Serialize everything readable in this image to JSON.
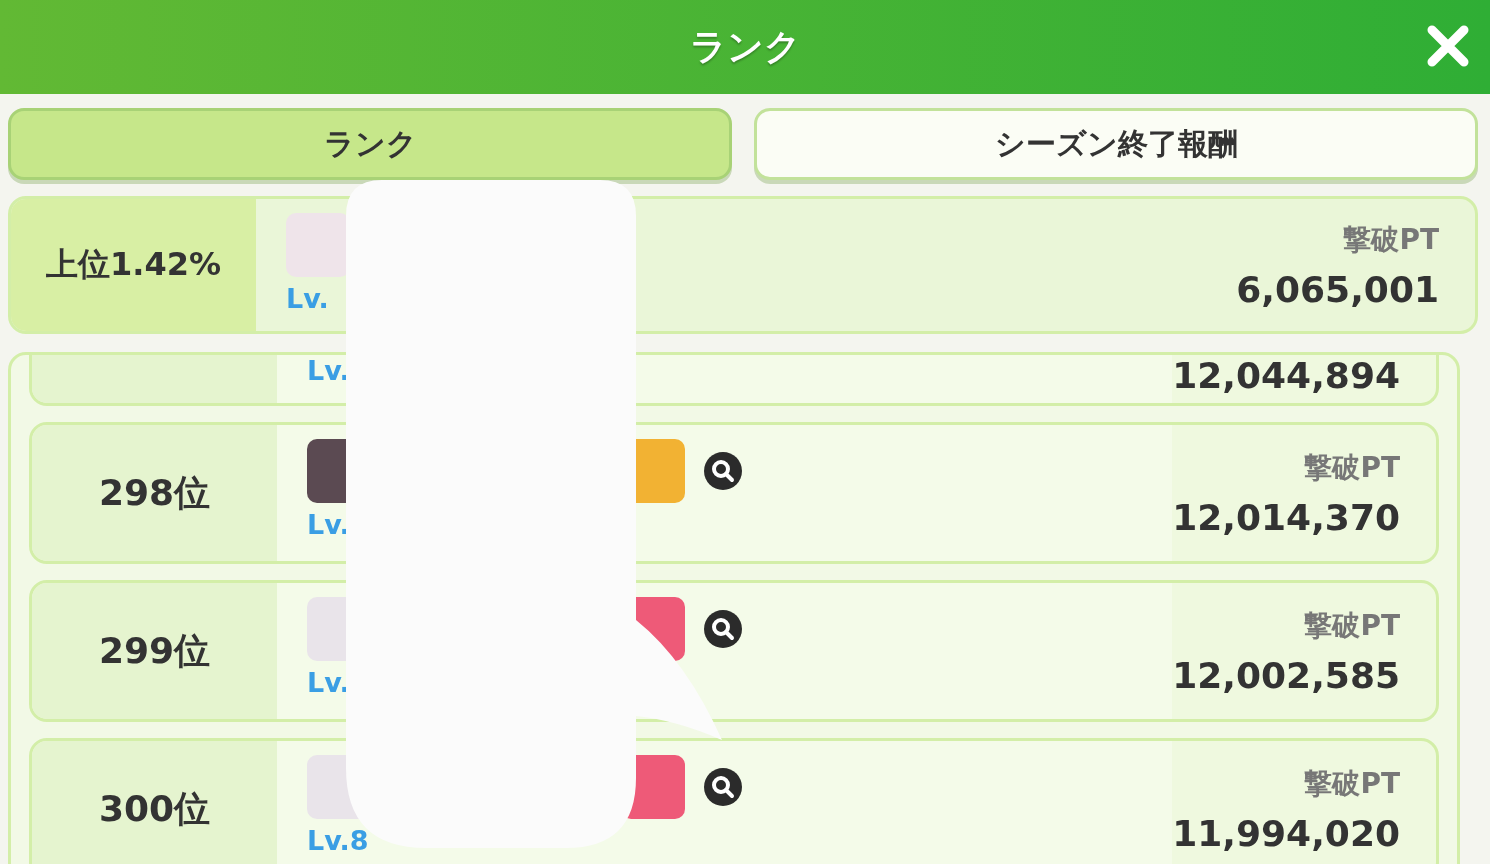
{
  "header": {
    "title": "ランク"
  },
  "tabs": [
    {
      "label": "ランク",
      "selected": true
    },
    {
      "label": "シーズン終了報酬",
      "selected": false
    }
  ],
  "my_rank": {
    "rank": "上位1.42%",
    "level": "Lv.",
    "score_label": "撃破PT",
    "score": "6,065,001"
  },
  "rows": [
    {
      "level": "Lv.",
      "score": "12,044,894"
    },
    {
      "rank": "298位",
      "level": "Lv.",
      "score_label": "撃破PT",
      "score": "12,014,370"
    },
    {
      "rank": "299位",
      "level": "Lv.",
      "score_label": "撃破PT",
      "score": "12,002,585"
    },
    {
      "rank": "300位",
      "level": "Lv.8",
      "score_label": "撃破PT",
      "score": "11,994,020"
    }
  ]
}
